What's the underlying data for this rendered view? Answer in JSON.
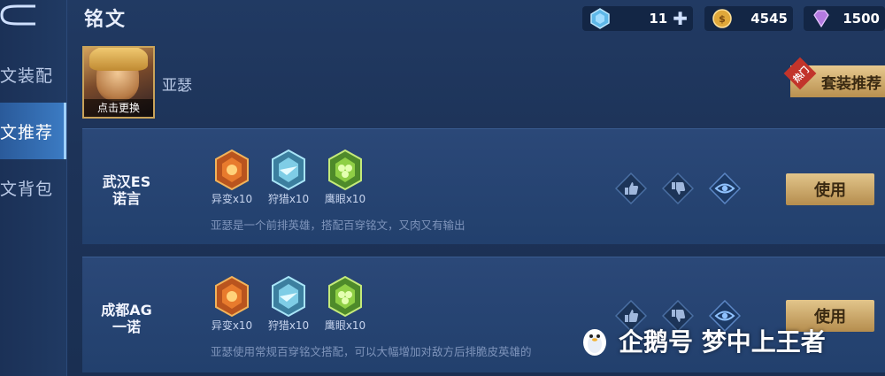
{
  "header": {
    "title": "铭文",
    "currencies": [
      {
        "name": "gem-icon",
        "value": "11"
      },
      {
        "name": "gold-coin-icon",
        "value": "4545"
      },
      {
        "name": "diamond-icon",
        "value": "1500"
      }
    ]
  },
  "sidebar": {
    "items": [
      {
        "label": "文装配"
      },
      {
        "label": "文推荐"
      },
      {
        "label": "文背包"
      }
    ],
    "active": "文推荐"
  },
  "hero": {
    "name": "亚瑟",
    "change_label": "点击更换"
  },
  "suit_button": {
    "label": "套装推荐",
    "badge": "热门"
  },
  "cards": [
    {
      "author_line1": "武汉ES",
      "author_line2": "诺言",
      "runes": [
        {
          "label": "异变x10"
        },
        {
          "label": "狩猎x10"
        },
        {
          "label": "鹰眼x10"
        }
      ],
      "description": "亚瑟是一个前排英雄，搭配百穿铭文，又肉又有输出",
      "use_label": "使用"
    },
    {
      "author_line1": "成都AG",
      "author_line2": "一诺",
      "runes": [
        {
          "label": "异变x10"
        },
        {
          "label": "狩猎x10"
        },
        {
          "label": "鹰眼x10"
        }
      ],
      "description": "亚瑟使用常规百穿铭文搭配，可以大幅增加对敌方后排脆皮英雄的",
      "use_label": "使用"
    }
  ],
  "watermark": {
    "text": "企鹅号 梦中上王者"
  },
  "colors": {
    "accent_gold": "#d9b878",
    "background": "#1d3358",
    "active_tab": "#3c7cc4"
  }
}
